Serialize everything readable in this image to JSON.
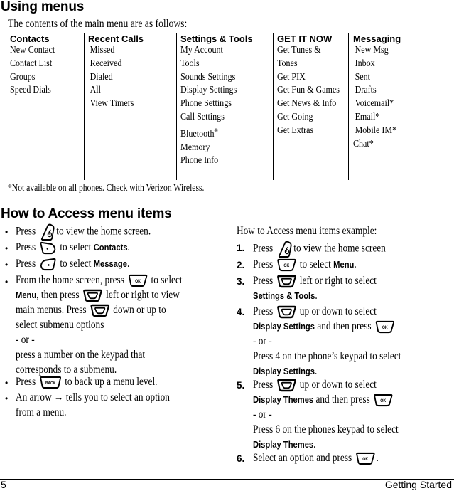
{
  "section1": {
    "title": "Using menus",
    "intro": "The contents of the main menu are as follows:",
    "menu_columns": [
      {
        "header": "Contacts",
        "items": [
          "New Contact",
          "Contact List",
          "Groups",
          "Speed Dials"
        ]
      },
      {
        "header": "Recent Calls",
        "items": [
          "Missed",
          "Received",
          "Dialed",
          "All",
          "View Timers"
        ]
      },
      {
        "header": "Settings & Tools",
        "items": [
          "My Account",
          "Tools",
          "Sounds Settings",
          "Display Settings",
          "Phone Settings",
          "Call Settings",
          "Bluetooth",
          "Memory",
          "Phone Info"
        ],
        "bluetooth_mark": "®"
      },
      {
        "header": "GET IT NOW",
        "items": [
          "Get Tunes &",
          "Tones",
          "Get PIX",
          "Get Fun & Games",
          "Get News & Info",
          "Get Going",
          "Get Extras"
        ]
      },
      {
        "header": "Messaging",
        "items": [
          "New Msg",
          "Inbox",
          "Sent",
          "Drafts",
          "Voicemail*",
          "Email*",
          "Mobile IM*",
          "Chat*"
        ]
      }
    ],
    "footnote": "*Not available on all phones. Check with Verizon Wireless."
  },
  "section2": {
    "title": "How to Access menu items",
    "bullets": {
      "b1_pre": "Press",
      "b1_post": "to view the home screen.",
      "b2_pre": "Press",
      "b2_mid": "to select",
      "b2_bold": "Contacts",
      "b2_end": ".",
      "b3_pre": "Press",
      "b3_mid": "to select",
      "b3_bold": "Message",
      "b3_end": ".",
      "b4_l1_pre": "From the home screen, press",
      "b4_l1_post": "to select",
      "b4_l2_bold": "Menu",
      "b4_l2_mid": ", then press",
      "b4_l2_post": "left or right to view",
      "b4_l3_pre": "main menus. Press",
      "b4_l3_post": "down or up to",
      "b4_l4": "select submenu options",
      "b4_l5": "- or -",
      "b4_l6": "press a number on the keypad that",
      "b4_l7": "corresponds to a submenu.",
      "b5_pre": "Press",
      "b5_post": "to back up a menu level.",
      "b6_l1": "An arrow → tells you to select an option",
      "b6_l2": "from a menu."
    },
    "bullet_char": "•",
    "example": {
      "title": "How to Access menu items example:",
      "s1_num": "1.",
      "s1_pre": "Press",
      "s1_post": "to view the home screen",
      "s2_num": "2.",
      "s2_pre": "Press",
      "s2_mid": "to select",
      "s2_bold": "Menu",
      "s2_end": ".",
      "s3_num": "3.",
      "s3_pre": "Press",
      "s3_post": "left or right to select",
      "s3_bold": "Settings & Tools",
      "s3_end": ".",
      "s4_num": "4.",
      "s4_pre": "Press",
      "s4_post": "up or down to select",
      "s4_bold": "Display Settings",
      "s4_mid": "and then press",
      "s4_or": "- or -",
      "s4_alt": "Press 4 on the phone’s keypad to select",
      "s4_bold2": "Display Settings",
      "s4_end": ".",
      "s5_num": "5.",
      "s5_pre": "Press",
      "s5_post": "up or down to select",
      "s5_bold": "Display Themes",
      "s5_mid": "and then press",
      "s5_or": "- or -",
      "s5_alt": "Press 6 on the phones keypad to select",
      "s5_bold2": "Display Themes",
      "s5_end": ".",
      "s6_num": "6.",
      "s6_pre": "Select an option and press",
      "s6_end": "."
    },
    "key_labels": {
      "ok": "OK",
      "back": "BACK"
    }
  },
  "footer": {
    "page_number": "5",
    "section_name": "Getting Started"
  }
}
